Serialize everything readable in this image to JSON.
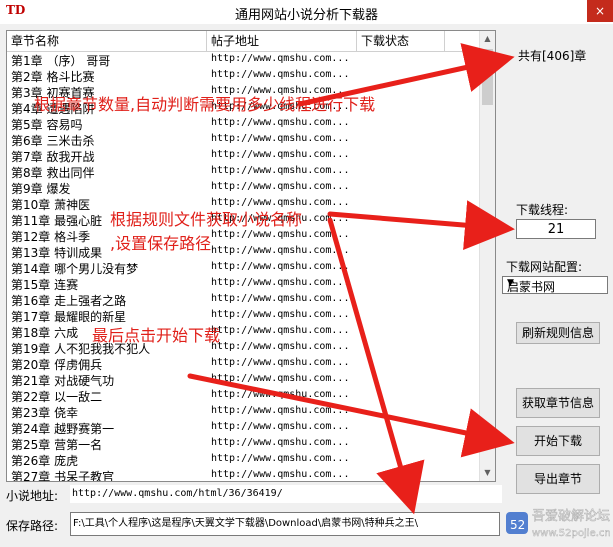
{
  "window": {
    "app_icon_text": "TD",
    "title": "通用网站小说分析下载器",
    "close_glyph": "×"
  },
  "table": {
    "columns": [
      "章节名称",
      "帖子地址",
      "下载状态"
    ],
    "rows": [
      {
        "name": "第1章 （序） 哥哥",
        "url": "http://www.qmshu.com..."
      },
      {
        "name": "第2章 格斗比赛",
        "url": "http://www.qmshu.com..."
      },
      {
        "name": "第3章 初赛首赛",
        "url": "http://www.qmshu.com..."
      },
      {
        "name": "第4章 遭遇陷阱",
        "url": "http://www.qmshu.com..."
      },
      {
        "name": "第5章 容易吗",
        "url": "http://www.qmshu.com..."
      },
      {
        "name": "第6章 三米击杀",
        "url": "http://www.qmshu.com..."
      },
      {
        "name": "第7章 敌我开战",
        "url": "http://www.qmshu.com..."
      },
      {
        "name": "第8章 救出同伴",
        "url": "http://www.qmshu.com..."
      },
      {
        "name": "第9章 爆发",
        "url": "http://www.qmshu.com..."
      },
      {
        "name": "第10章 萧神医",
        "url": "http://www.qmshu.com..."
      },
      {
        "name": "第11章 最强心脏",
        "url": "http://www.qmshu.com..."
      },
      {
        "name": "第12章 格斗季",
        "url": "http://www.qmshu.com..."
      },
      {
        "name": "第13章 特训成果",
        "url": "http://www.qmshu.com..."
      },
      {
        "name": "第14章 哪个男儿没有梦",
        "url": "http://www.qmshu.com..."
      },
      {
        "name": "第15章 连赛",
        "url": "http://www.qmshu.com..."
      },
      {
        "name": "第16章 走上强者之路",
        "url": "http://www.qmshu.com..."
      },
      {
        "name": "第17章 最耀眼的新星",
        "url": "http://www.qmshu.com..."
      },
      {
        "name": "第18章 六成",
        "url": "http://www.qmshu.com..."
      },
      {
        "name": "第19章 人不犯我我不犯人",
        "url": "http://www.qmshu.com..."
      },
      {
        "name": "第20章 俘虏佣兵",
        "url": "http://www.qmshu.com..."
      },
      {
        "name": "第21章 对战硬气功",
        "url": "http://www.qmshu.com..."
      },
      {
        "name": "第22章 以一敌二",
        "url": "http://www.qmshu.com..."
      },
      {
        "name": "第23章 侥幸",
        "url": "http://www.qmshu.com..."
      },
      {
        "name": "第24章 越野赛第一",
        "url": "http://www.qmshu.com..."
      },
      {
        "name": "第25章 营第一名",
        "url": "http://www.qmshu.com..."
      },
      {
        "name": "第26章 庞虎",
        "url": "http://www.qmshu.com..."
      },
      {
        "name": "第27章 书呆子教官",
        "url": "http://www.qmshu.com..."
      }
    ]
  },
  "side": {
    "chapter_count": "共有[406]章",
    "threads_label": "下载线程:",
    "threads_value": "21",
    "site_config_label": "下载网站配置:",
    "site_selected": "启蒙书网",
    "refresh_button": "刷新规则信息",
    "fetch_button": "获取章节信息",
    "start_button": "开始下载",
    "export_button": "导出章节"
  },
  "bottom": {
    "url_label": "小说地址:",
    "url_value": "http://www.qmshu.com/html/36/36419/",
    "path_label": "保存路径:",
    "path_value": "F:\\工具\\个人程序\\这是程序\\天翼文学下载器\\Download\\启蒙书网\\特种兵之王\\"
  },
  "annotations": {
    "a1": "根据章节数量,自动判断需要用多少线程进行下载",
    "a2": "根据规则文件获取小说名称",
    "a3": ",设置保存路径",
    "a4": "最后点击开始下载"
  },
  "watermark": {
    "brand": "吾爱破解论坛",
    "site": "www.52pojie.cn"
  },
  "colors": {
    "annotation_red": "#e0201a",
    "close_red": "#c42b1c"
  },
  "icons": {
    "scroll_up": "▲",
    "scroll_down": "▼",
    "dropdown": "▼"
  }
}
